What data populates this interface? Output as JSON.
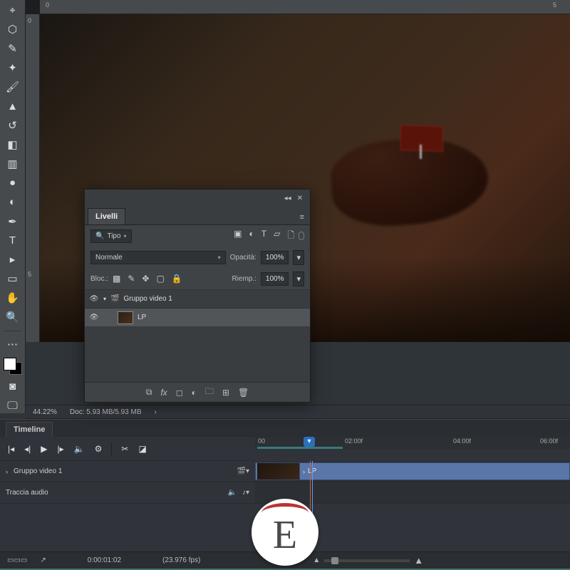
{
  "ruler_h": [
    "0",
    "5"
  ],
  "ruler_v": [
    "0",
    "5"
  ],
  "layers_panel": {
    "tab": "Livelli",
    "search_label": "Tipo",
    "blend_mode": "Normale",
    "opacity_label": "Opacità:",
    "opacity_value": "100%",
    "fill_label": "Riemp.:",
    "fill_value": "100%",
    "lock_label": "Bloc.:",
    "group_name": "Gruppo video 1",
    "layer_name": "LP"
  },
  "status": {
    "zoom": "44.22%",
    "doc": "Doc: 5.93 MB/5.93 MB"
  },
  "timeline": {
    "tab": "Timeline",
    "ruler": [
      "00",
      "02:00f",
      "04:00f",
      "06:00f"
    ],
    "group_track": "Gruppo video 1",
    "audio_track": "Traccia audio",
    "clip_name": "LP",
    "time": "0:00:01:02",
    "fps": "(23.976 fps)"
  },
  "logo_letter": "E"
}
